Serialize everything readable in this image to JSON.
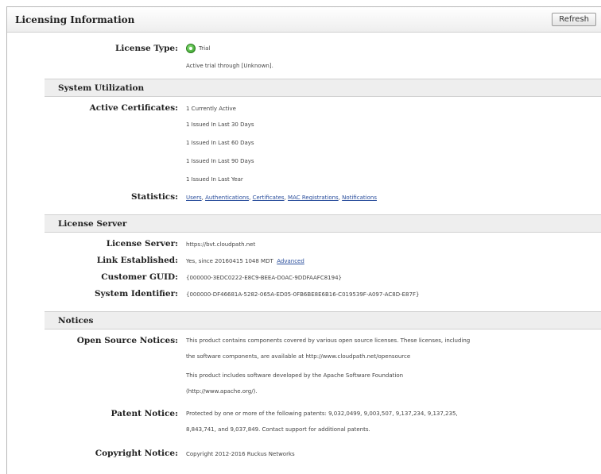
{
  "header": {
    "title": "Licensing Information",
    "refresh_label": "Refresh"
  },
  "license": {
    "type_label": "License Type:",
    "type_value": "Trial",
    "trial_note": "Active trial through [Unknown]."
  },
  "system_utilization": {
    "heading": "System Utilization",
    "active_certs_label": "Active Certificates:",
    "active_certs": [
      "1 Currently Active",
      "1 Issued In Last 30 Days",
      "1 Issued In Last 60 Days",
      "1 Issued In Last 90 Days",
      "1 Issued In Last Year"
    ],
    "statistics_label": "Statistics:",
    "statistics_links": [
      "Users",
      "Authentications",
      "Certificates",
      "MAC Registrations",
      "Notifications"
    ]
  },
  "license_server": {
    "heading": "License Server",
    "server_label": "License Server:",
    "server_value": "https://bvt.cloudpath.net",
    "link_label": "Link Established:",
    "link_value": "Yes, since 20160415 1048 MDT",
    "link_advanced": "Advanced",
    "guid_label": "Customer GUID:",
    "guid_value": "{000000-3EDC0222-E8C9-BEEA-D0AC-9DDFAAFC8194}",
    "sysid_label": "System Identifier:",
    "sysid_value": "{000000-DF46681A-5282-065A-ED05-0FB6BE8E6B16-C019539F-A097-AC8D-E87F}"
  },
  "notices": {
    "heading": "Notices",
    "open_source_label": "Open Source Notices:",
    "open_source_p1a": "This product contains components covered by various open source licenses. These licenses, including",
    "open_source_p1b": "the software components, are available at http://www.cloudpath.net/opensource",
    "open_source_p2a": "This product includes software developed by the Apache Software Foundation",
    "open_source_p2b": "(http://www.apache.org/).",
    "patent_label": "Patent Notice:",
    "patent_a": "Protected by one or more of the following patents: 9,032,0499, 9,003,507, 9,137,234, 9,137,235,",
    "patent_b": "8,843,741, and 9,037,849. Contact support for additional patents.",
    "copyright_label": "Copyright Notice:",
    "copyright_value": "Copyright 2012-2016 Ruckus Networks"
  }
}
